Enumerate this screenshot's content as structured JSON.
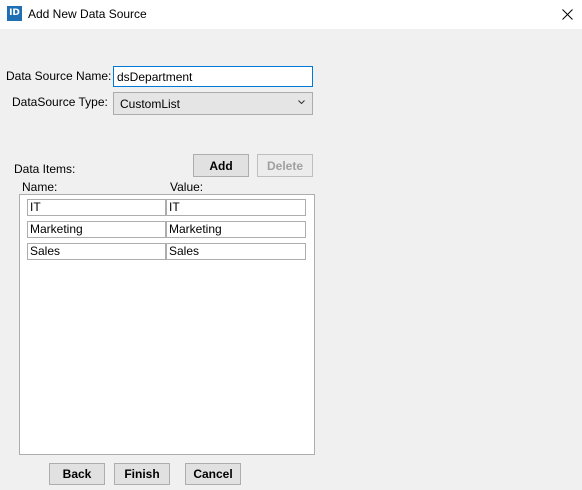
{
  "window": {
    "icon_text": "ID",
    "title": "Add New Data Source"
  },
  "form": {
    "source_name_label": "Data Source Name:",
    "source_name_value": "dsDepartment",
    "source_type_label": "DataSource Type:",
    "source_type_value": "CustomList"
  },
  "items": {
    "section_label": "Data Items:",
    "add_label": "Add",
    "delete_label": "Delete",
    "name_header": "Name:",
    "value_header": "Value:",
    "rows": [
      {
        "name": "IT",
        "value": "IT"
      },
      {
        "name": "Marketing",
        "value": "Marketing"
      },
      {
        "name": "Sales",
        "value": "Sales"
      }
    ]
  },
  "footer": {
    "back_label": "Back",
    "finish_label": "Finish",
    "cancel_label": "Cancel"
  },
  "colors": {
    "focus_border": "#0078d7",
    "app_icon": "#1f6fb3",
    "dialog_background": "#f0f0f0"
  }
}
